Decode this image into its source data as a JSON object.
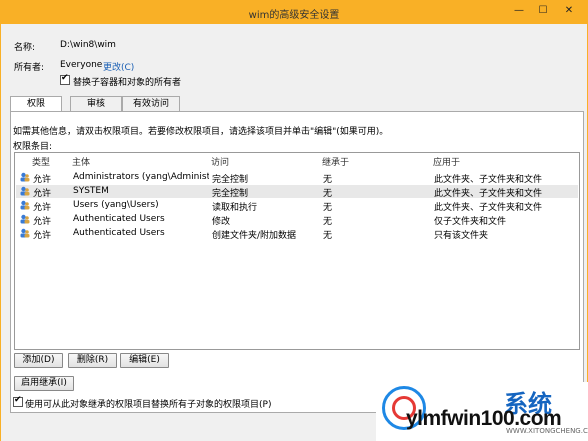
{
  "window": {
    "title": "wim的高级安全设置",
    "min": "—",
    "max": "☐",
    "close": "✕"
  },
  "info": {
    "name_label": "名称:",
    "name_value": "D:\\win8\\wim",
    "owner_label": "所有者:",
    "owner_value": "Everyone",
    "change_link": "更改(C)",
    "replace_owner_label": "替换子容器和对象的所有者"
  },
  "tabs": [
    "权限",
    "审核",
    "有效访问"
  ],
  "panel": {
    "help_text": "如需其他信息，请双击权限项目。若要修改权限项目，请选择该项目并单击\"编辑\"(如果可用)。",
    "entries_label": "权限条目:",
    "columns": [
      "类型",
      "主体",
      "访问",
      "继承于",
      "应用于"
    ],
    "rows": [
      {
        "type": "允许",
        "principal": "Administrators (yang\\Administra...",
        "access": "完全控制",
        "inherit": "无",
        "applies": "此文件夹、子文件夹和文件"
      },
      {
        "type": "允许",
        "principal": "SYSTEM",
        "access": "完全控制",
        "inherit": "无",
        "applies": "此文件夹、子文件夹和文件"
      },
      {
        "type": "允许",
        "principal": "Users (yang\\Users)",
        "access": "读取和执行",
        "inherit": "无",
        "applies": "此文件夹、子文件夹和文件"
      },
      {
        "type": "允许",
        "principal": "Authenticated Users",
        "access": "修改",
        "inherit": "无",
        "applies": "仅子文件夹和文件"
      },
      {
        "type": "允许",
        "principal": "Authenticated Users",
        "access": "创建文件夹/附加数据",
        "inherit": "无",
        "applies": "只有该文件夹"
      }
    ],
    "add_button": "添加(D)",
    "remove_button": "删除(R)",
    "edit_button": "编辑(E)",
    "enable_inheritance_button": "启用继承(I)",
    "replace_child_label": "使用可从此对象继承的权限项目替换所有子对象的权限项目(P)"
  },
  "watermark": {
    "brand": "ylmfwin100.com",
    "cn": "系统",
    "url": "WWW.XITONGCHENG.COM"
  },
  "colors": {
    "titlebar": "#f9b026",
    "link": "#1a5fb4",
    "selected_row": "#e8e8e8"
  }
}
